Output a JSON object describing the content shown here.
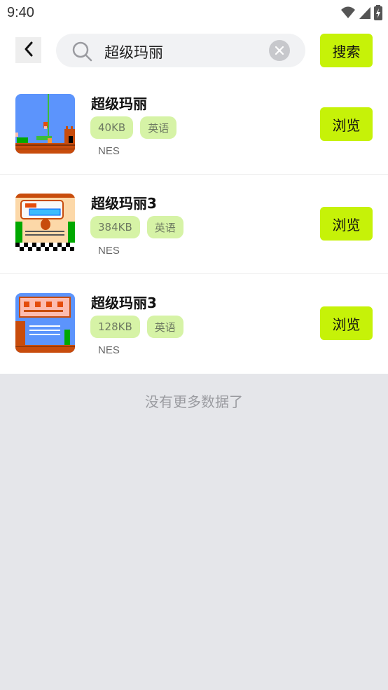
{
  "status_bar": {
    "time": "9:40"
  },
  "search": {
    "query": "超级玛丽",
    "button_label": "搜索"
  },
  "results": [
    {
      "title": "超级玛丽",
      "size": "40KB",
      "language": "英语",
      "platform": "NES",
      "action_label": "浏览",
      "thumbnail": "game-screenshot-flagpole"
    },
    {
      "title": "超级玛丽3",
      "size": "384KB",
      "language": "英语",
      "platform": "NES",
      "action_label": "浏览",
      "thumbnail": "game-title-screen"
    },
    {
      "title": "超级玛丽3",
      "size": "128KB",
      "language": "英语",
      "platform": "NES",
      "action_label": "浏览",
      "thumbnail": "game-menu-screen"
    }
  ],
  "footer": {
    "no_more_text": "没有更多数据了"
  },
  "colors": {
    "accent": "#c6f208",
    "tag_bg": "#d6f3a6",
    "page_bg": "#e5e6ea"
  }
}
